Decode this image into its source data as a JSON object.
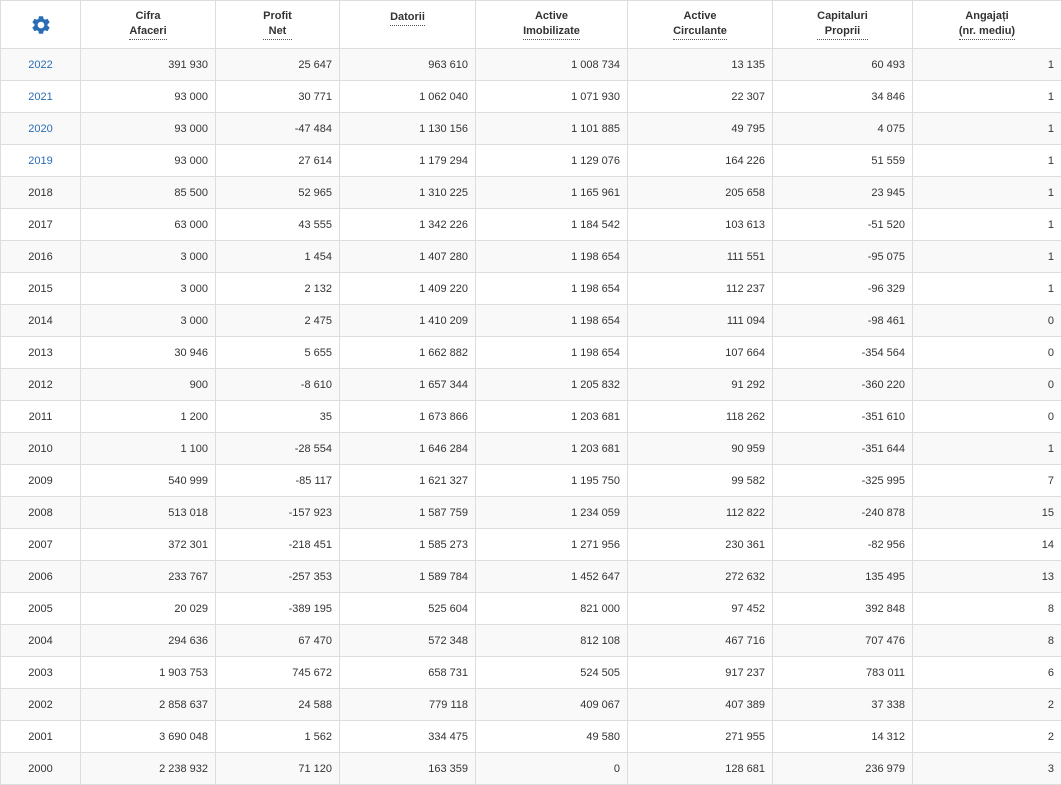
{
  "header": {
    "settings_icon": "gear-icon",
    "accent_color": "#2a6db5",
    "columns": [
      {
        "key": "cifra_afaceri",
        "line1": "Cifra",
        "line2": "Afaceri"
      },
      {
        "key": "profit_net",
        "line1": "Profit",
        "line2": "Net"
      },
      {
        "key": "datorii",
        "line1": "Datorii",
        "line2": ""
      },
      {
        "key": "active_imobilizate",
        "line1": "Active",
        "line2": "Imobilizate"
      },
      {
        "key": "active_circulante",
        "line1": "Active",
        "line2": "Circulante"
      },
      {
        "key": "capitaluri_proprii",
        "line1": "Capitaluri",
        "line2": "Proprii"
      },
      {
        "key": "angajati",
        "line1": "Angajați",
        "line2": "(nr. mediu)"
      }
    ]
  },
  "rows": [
    {
      "year": "2022",
      "link": true,
      "cifra_afaceri": "391 930",
      "profit_net": "25 647",
      "datorii": "963 610",
      "active_imobilizate": "1 008 734",
      "active_circulante": "13 135",
      "capitaluri_proprii": "60 493",
      "angajati": "1"
    },
    {
      "year": "2021",
      "link": true,
      "cifra_afaceri": "93 000",
      "profit_net": "30 771",
      "datorii": "1 062 040",
      "active_imobilizate": "1 071 930",
      "active_circulante": "22 307",
      "capitaluri_proprii": "34 846",
      "angajati": "1"
    },
    {
      "year": "2020",
      "link": true,
      "cifra_afaceri": "93 000",
      "profit_net": "-47 484",
      "datorii": "1 130 156",
      "active_imobilizate": "1 101 885",
      "active_circulante": "49 795",
      "capitaluri_proprii": "4 075",
      "angajati": "1"
    },
    {
      "year": "2019",
      "link": true,
      "cifra_afaceri": "93 000",
      "profit_net": "27 614",
      "datorii": "1 179 294",
      "active_imobilizate": "1 129 076",
      "active_circulante": "164 226",
      "capitaluri_proprii": "51 559",
      "angajati": "1"
    },
    {
      "year": "2018",
      "link": false,
      "cifra_afaceri": "85 500",
      "profit_net": "52 965",
      "datorii": "1 310 225",
      "active_imobilizate": "1 165 961",
      "active_circulante": "205 658",
      "capitaluri_proprii": "23 945",
      "angajati": "1"
    },
    {
      "year": "2017",
      "link": false,
      "cifra_afaceri": "63 000",
      "profit_net": "43 555",
      "datorii": "1 342 226",
      "active_imobilizate": "1 184 542",
      "active_circulante": "103 613",
      "capitaluri_proprii": "-51 520",
      "angajati": "1"
    },
    {
      "year": "2016",
      "link": false,
      "cifra_afaceri": "3 000",
      "profit_net": "1 454",
      "datorii": "1 407 280",
      "active_imobilizate": "1 198 654",
      "active_circulante": "111 551",
      "capitaluri_proprii": "-95 075",
      "angajati": "1"
    },
    {
      "year": "2015",
      "link": false,
      "cifra_afaceri": "3 000",
      "profit_net": "2 132",
      "datorii": "1 409 220",
      "active_imobilizate": "1 198 654",
      "active_circulante": "112 237",
      "capitaluri_proprii": "-96 329",
      "angajati": "1"
    },
    {
      "year": "2014",
      "link": false,
      "cifra_afaceri": "3 000",
      "profit_net": "2 475",
      "datorii": "1 410 209",
      "active_imobilizate": "1 198 654",
      "active_circulante": "111 094",
      "capitaluri_proprii": "-98 461",
      "angajati": "0"
    },
    {
      "year": "2013",
      "link": false,
      "cifra_afaceri": "30 946",
      "profit_net": "5 655",
      "datorii": "1 662 882",
      "active_imobilizate": "1 198 654",
      "active_circulante": "107 664",
      "capitaluri_proprii": "-354 564",
      "angajati": "0"
    },
    {
      "year": "2012",
      "link": false,
      "cifra_afaceri": "900",
      "profit_net": "-8 610",
      "datorii": "1 657 344",
      "active_imobilizate": "1 205 832",
      "active_circulante": "91 292",
      "capitaluri_proprii": "-360 220",
      "angajati": "0"
    },
    {
      "year": "2011",
      "link": false,
      "cifra_afaceri": "1 200",
      "profit_net": "35",
      "datorii": "1 673 866",
      "active_imobilizate": "1 203 681",
      "active_circulante": "118 262",
      "capitaluri_proprii": "-351 610",
      "angajati": "0"
    },
    {
      "year": "2010",
      "link": false,
      "cifra_afaceri": "1 100",
      "profit_net": "-28 554",
      "datorii": "1 646 284",
      "active_imobilizate": "1 203 681",
      "active_circulante": "90 959",
      "capitaluri_proprii": "-351 644",
      "angajati": "1"
    },
    {
      "year": "2009",
      "link": false,
      "cifra_afaceri": "540 999",
      "profit_net": "-85 117",
      "datorii": "1 621 327",
      "active_imobilizate": "1 195 750",
      "active_circulante": "99 582",
      "capitaluri_proprii": "-325 995",
      "angajati": "7"
    },
    {
      "year": "2008",
      "link": false,
      "cifra_afaceri": "513 018",
      "profit_net": "-157 923",
      "datorii": "1 587 759",
      "active_imobilizate": "1 234 059",
      "active_circulante": "112 822",
      "capitaluri_proprii": "-240 878",
      "angajati": "15"
    },
    {
      "year": "2007",
      "link": false,
      "cifra_afaceri": "372 301",
      "profit_net": "-218 451",
      "datorii": "1 585 273",
      "active_imobilizate": "1 271 956",
      "active_circulante": "230 361",
      "capitaluri_proprii": "-82 956",
      "angajati": "14"
    },
    {
      "year": "2006",
      "link": false,
      "cifra_afaceri": "233 767",
      "profit_net": "-257 353",
      "datorii": "1 589 784",
      "active_imobilizate": "1 452 647",
      "active_circulante": "272 632",
      "capitaluri_proprii": "135 495",
      "angajati": "13"
    },
    {
      "year": "2005",
      "link": false,
      "cifra_afaceri": "20 029",
      "profit_net": "-389 195",
      "datorii": "525 604",
      "active_imobilizate": "821 000",
      "active_circulante": "97 452",
      "capitaluri_proprii": "392 848",
      "angajati": "8"
    },
    {
      "year": "2004",
      "link": false,
      "cifra_afaceri": "294 636",
      "profit_net": "67 470",
      "datorii": "572 348",
      "active_imobilizate": "812 108",
      "active_circulante": "467 716",
      "capitaluri_proprii": "707 476",
      "angajati": "8"
    },
    {
      "year": "2003",
      "link": false,
      "cifra_afaceri": "1 903 753",
      "profit_net": "745 672",
      "datorii": "658 731",
      "active_imobilizate": "524 505",
      "active_circulante": "917 237",
      "capitaluri_proprii": "783 011",
      "angajati": "6"
    },
    {
      "year": "2002",
      "link": false,
      "cifra_afaceri": "2 858 637",
      "profit_net": "24 588",
      "datorii": "779 118",
      "active_imobilizate": "409 067",
      "active_circulante": "407 389",
      "capitaluri_proprii": "37 338",
      "angajati": "2"
    },
    {
      "year": "2001",
      "link": false,
      "cifra_afaceri": "3 690 048",
      "profit_net": "1 562",
      "datorii": "334 475",
      "active_imobilizate": "49 580",
      "active_circulante": "271 955",
      "capitaluri_proprii": "14 312",
      "angajati": "2"
    },
    {
      "year": "2000",
      "link": false,
      "cifra_afaceri": "2 238 932",
      "profit_net": "71 120",
      "datorii": "163 359",
      "active_imobilizate": "0",
      "active_circulante": "128 681",
      "capitaluri_proprii": "236 979",
      "angajati": "3"
    }
  ]
}
